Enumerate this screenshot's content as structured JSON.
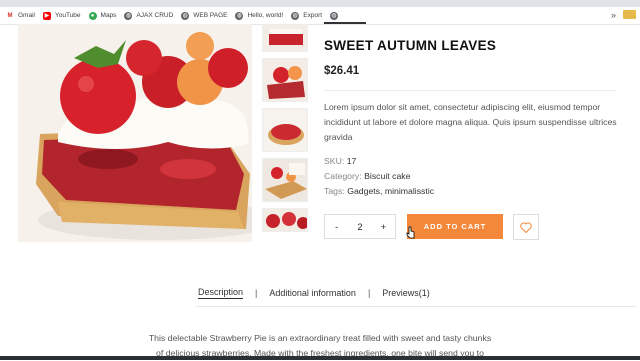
{
  "browser": {
    "bookmarks": [
      {
        "label": "Gmail",
        "icon": "gmail-icon",
        "color": "#d93025"
      },
      {
        "label": "YouTube",
        "icon": "youtube-icon",
        "color": "#ff0000"
      },
      {
        "label": "Maps",
        "icon": "maps-icon",
        "color": "#34a853"
      },
      {
        "label": "AJAX CRUD",
        "icon": "globe-icon",
        "color": "#5f6368"
      },
      {
        "label": "WEB PAGE",
        "icon": "globe-icon",
        "color": "#5f6368"
      },
      {
        "label": "Hello, world!",
        "icon": "globe-icon",
        "color": "#5f6368"
      },
      {
        "label": "Export",
        "icon": "globe-icon",
        "color": "#5f6368"
      }
    ],
    "more": "»"
  },
  "product": {
    "title": "SWEET AUTUMN LEAVES",
    "price": "$26.41",
    "description": "Lorem ipsum dolor sit amet, consectetur adipiscing elit, eiusmod tempor incididunt ut labore et dolore magna aliqua. Quis ipsum suspendisse ultrices gravida",
    "sku_label": "SKU:",
    "sku_value": "17",
    "category_label": "Category:",
    "category_value": "Biscuit cake",
    "tags_label": "Tags:",
    "tags_value": "Gadgets, minimalisstic",
    "quantity": "2",
    "minus": "-",
    "plus": "+",
    "add_to_cart": "ADD TO CART"
  },
  "tabs": {
    "items": [
      "Description",
      "Additional information",
      "Previews(1)"
    ],
    "separator": "|",
    "active": "Description"
  },
  "details": {
    "line1": "This delectable Strawberry Pie is an extraordinary treat filled with sweet and tasty chunks",
    "line2": "of delicious strawberries. Made with the freshest ingredients, one bite will send you to"
  },
  "colors": {
    "accent": "#f4883a",
    "title": "#111111",
    "text": "#555555"
  }
}
